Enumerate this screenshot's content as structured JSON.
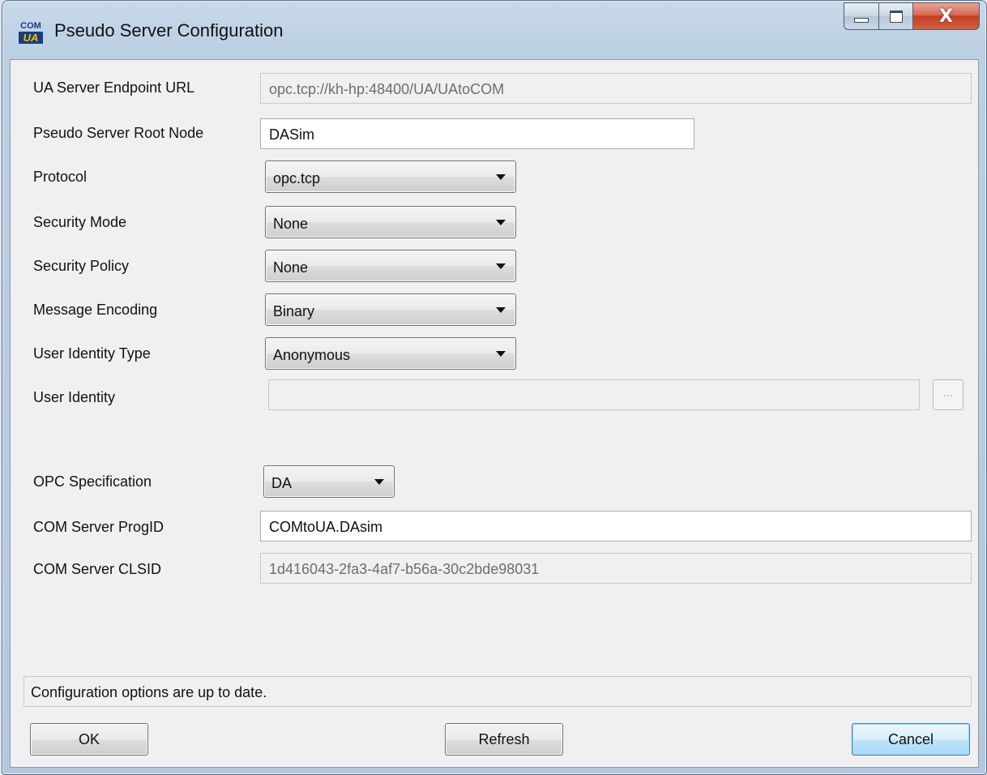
{
  "window": {
    "title": "Pseudo Server Configuration",
    "icon": {
      "name": "com-ua-app-icon",
      "top_text": "COM",
      "bottom_text": "UA"
    },
    "controls": {
      "minimize": "minimize-icon",
      "maximize": "maximize-icon",
      "close": "X"
    }
  },
  "form": {
    "endpoint_url": {
      "label": "UA Server Endpoint URL",
      "value": "opc.tcp://kh-hp:48400/UA/UAtoCOM"
    },
    "root_node": {
      "label": "Pseudo Server Root Node",
      "value": "DASim"
    },
    "protocol": {
      "label": "Protocol",
      "value": "opc.tcp"
    },
    "security_mode": {
      "label": "Security Mode",
      "value": "None"
    },
    "security_policy": {
      "label": "Security Policy",
      "value": "None"
    },
    "message_encoding": {
      "label": "Message Encoding",
      "value": "Binary"
    },
    "user_identity_type": {
      "label": "User Identity Type",
      "value": "Anonymous"
    },
    "user_identity": {
      "label": "User Identity",
      "value": "",
      "browse_label": "..."
    },
    "opc_specification": {
      "label": "OPC Specification",
      "value": "DA"
    },
    "com_progid": {
      "label": "COM Server ProgID",
      "value": "COMtoUA.DAsim"
    },
    "com_clsid": {
      "label": "COM Server CLSID",
      "value": "1d416043-2fa3-4af7-b56a-30c2bde98031"
    }
  },
  "status": {
    "text": "Configuration options are up to date."
  },
  "buttons": {
    "ok": "OK",
    "refresh": "Refresh",
    "cancel": "Cancel"
  },
  "colors": {
    "titlebar": "#bcd0e4",
    "close_button": "#c23e22",
    "client_bg": "#f0f0f0",
    "default_button_border": "#3c7fb1"
  }
}
